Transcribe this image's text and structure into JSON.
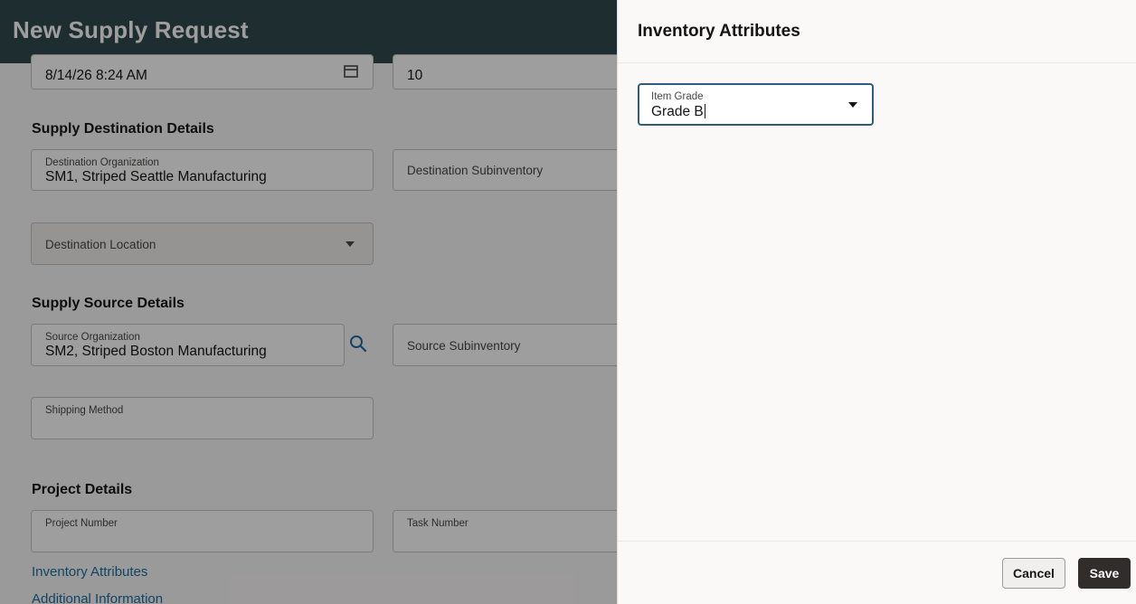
{
  "page": {
    "title": "New Supply Request",
    "top_fields": {
      "date_value": "8/14/26 8:24 AM",
      "quantity_value": "10"
    },
    "destination": {
      "section_title": "Supply Destination Details",
      "org_label": "Destination Organization",
      "org_value": "SM1, Striped Seattle Manufacturing",
      "subinventory_placeholder": "Destination Subinventory",
      "location_placeholder": "Destination Location"
    },
    "source": {
      "section_title": "Supply Source Details",
      "org_label": "Source Organization",
      "org_value": "SM2,  Striped Boston Manufacturing",
      "subinventory_placeholder": "Source Subinventory",
      "shipping_label": "Shipping Method"
    },
    "project": {
      "section_title": "Project Details",
      "project_number_label": "Project Number",
      "task_number_label": "Task Number"
    },
    "links": {
      "inventory_attributes": "Inventory Attributes",
      "additional_information": "Additional Information"
    }
  },
  "drawer": {
    "title": "Inventory Attributes",
    "item_grade": {
      "label": "Item Grade",
      "value": "Grade B"
    },
    "buttons": {
      "cancel": "Cancel",
      "save": "Save"
    }
  },
  "icons": {
    "calendar": "calendar-icon",
    "search": "search-icon",
    "dropdown": "chevron-down-icon"
  },
  "colors": {
    "header_bg": "#2f4a4e",
    "link": "#1b6ea1",
    "save_button": "#312d2a",
    "focus_border": "#2f5c7a"
  }
}
